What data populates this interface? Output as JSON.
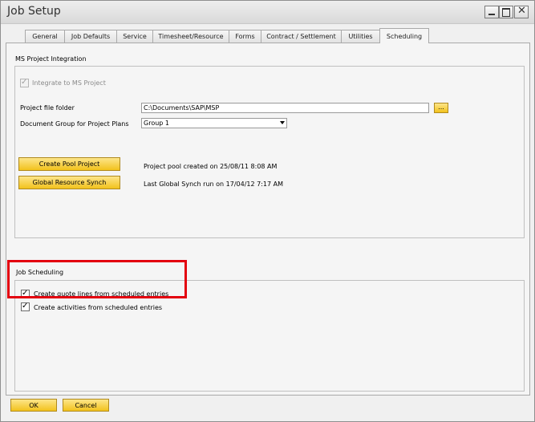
{
  "window": {
    "title": "Job Setup",
    "controls": [
      "minimize-icon",
      "maximize-icon",
      "close-icon"
    ]
  },
  "tabs": [
    {
      "label": "General",
      "active": false
    },
    {
      "label": "Job Defaults",
      "active": false
    },
    {
      "label": "Service",
      "active": false
    },
    {
      "label": "Timesheet/Resource",
      "active": false
    },
    {
      "label": "Forms",
      "active": false
    },
    {
      "label": "Contract / Settlement",
      "active": false
    },
    {
      "label": "Utilities",
      "active": false
    },
    {
      "label": "Scheduling",
      "active": true
    }
  ],
  "ms_project": {
    "section_title": "MS Project Integration",
    "integrate_label": "Integrate to MS Project",
    "integrate_checked": true,
    "integrate_disabled": true,
    "folder_label": "Project file folder",
    "folder_value": "C:\\Documents\\SAP\\MSP",
    "browse_label": "...",
    "doc_group_label": "Document Group for Project Plans",
    "doc_group_value": "Group 1",
    "create_pool_label": "Create Pool Project",
    "pool_status": "Project pool created on 25/08/11 8:08 AM",
    "global_synch_label": "Global Resource Synch",
    "synch_status": "Last Global Synch run on 17/04/12 7:17 AM"
  },
  "job_scheduling": {
    "section_title": "Job Scheduling",
    "quote_lines_label": "Create quote lines from scheduled entries",
    "quote_lines_checked": true,
    "activities_label": "Create activities from scheduled entries",
    "activities_checked": true
  },
  "footer": {
    "ok_label": "OK",
    "cancel_label": "Cancel"
  },
  "colors": {
    "button_yellow": "#f2c21c",
    "highlight_red": "#e3000f"
  }
}
